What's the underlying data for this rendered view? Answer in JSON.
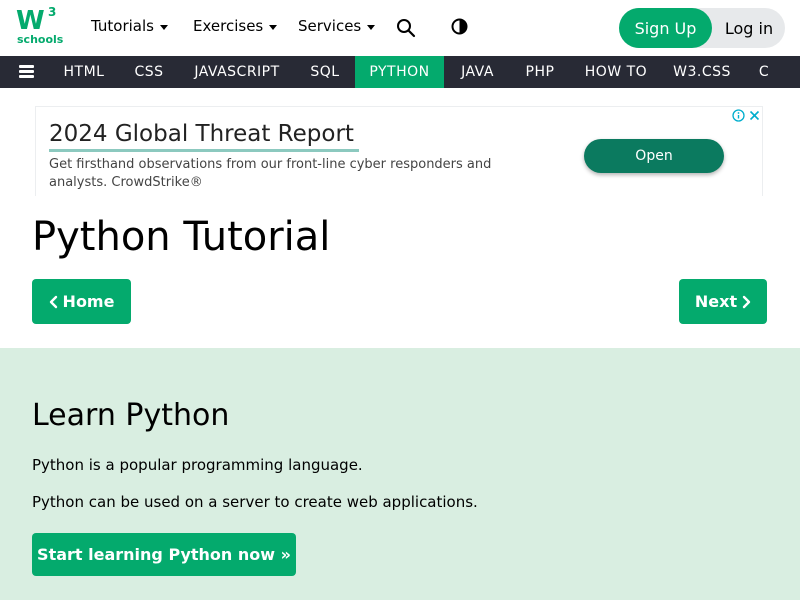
{
  "brand": {
    "logo_main": "W",
    "logo_sup": "3",
    "logo_sub": "schools",
    "accent": "#04aa6d"
  },
  "topnav": {
    "items": [
      {
        "label": "Tutorials"
      },
      {
        "label": "Exercises"
      },
      {
        "label": "Services"
      }
    ],
    "search_icon": "search-icon",
    "contrast_icon": "contrast-icon",
    "signup_label": "Sign Up",
    "login_label": "Log in"
  },
  "subnav": {
    "menu_icon": "hamburger-menu-icon",
    "links": [
      {
        "label": "HTML"
      },
      {
        "label": "CSS"
      },
      {
        "label": "JAVASCRIPT"
      },
      {
        "label": "SQL"
      },
      {
        "label": "PYTHON",
        "active": true
      },
      {
        "label": "JAVA"
      },
      {
        "label": "PHP"
      },
      {
        "label": "HOW TO"
      },
      {
        "label": "W3.CSS"
      },
      {
        "label": "C"
      }
    ],
    "background": "#282a35"
  },
  "ad": {
    "title": "2024 Global Threat Report",
    "text": "Get firsthand observations from our front-line cyber responders and analysts. CrowdStrike®",
    "cta": "Open"
  },
  "main": {
    "title": "Python Tutorial",
    "prev_label": "Home",
    "next_label": "Next"
  },
  "learn": {
    "heading": "Learn Python",
    "paragraphs": [
      "Python is a popular programming language.",
      "Python can be used on a server to create web applications."
    ],
    "cta": "Start learning Python now »",
    "background": "#d9eee1"
  }
}
